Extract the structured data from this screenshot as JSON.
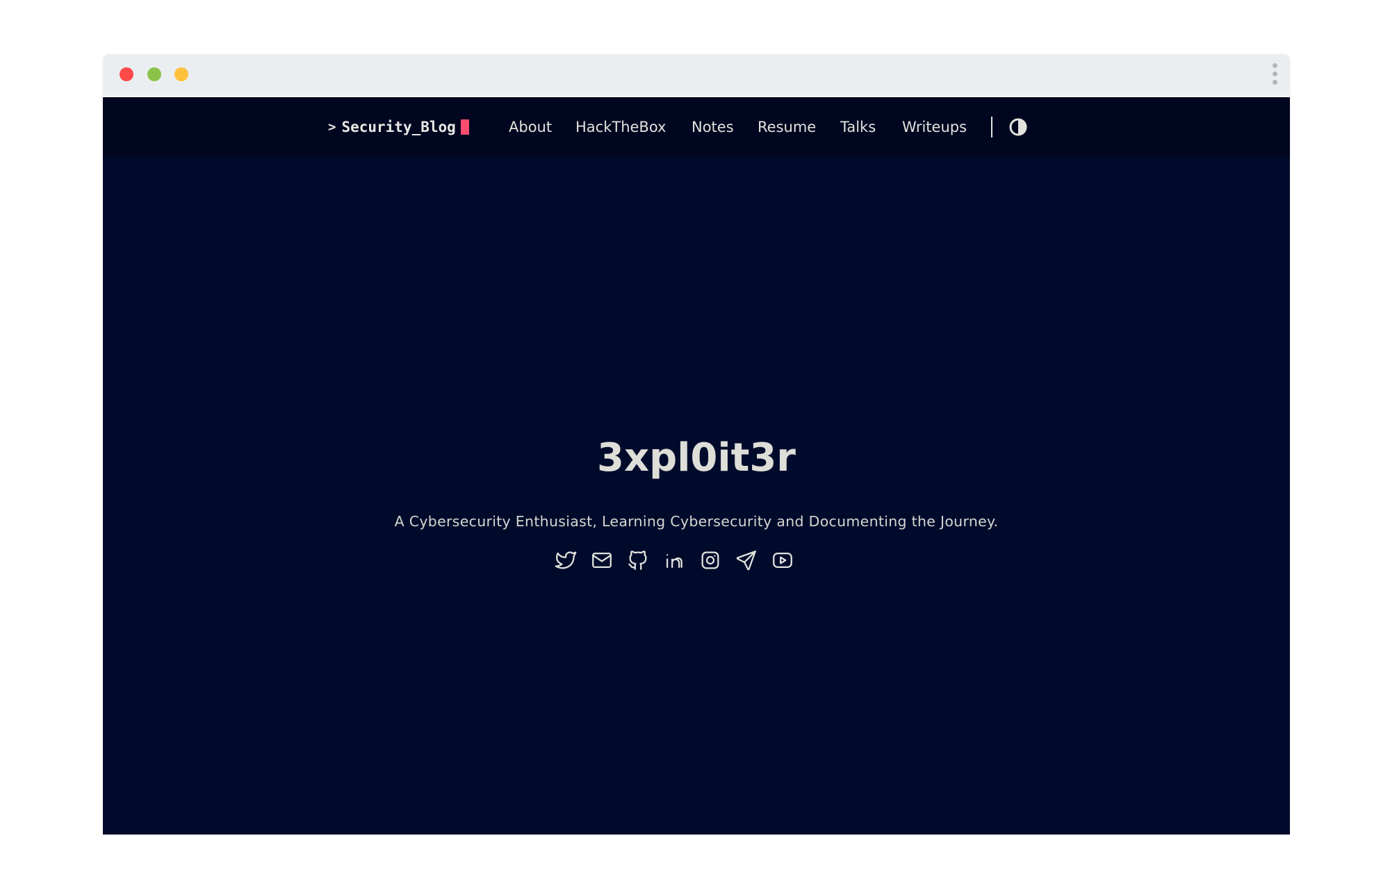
{
  "colors": {
    "page_background": "#000b2c",
    "nav_background": "#00061f",
    "text": "#e3e3dd",
    "cursor_accent": "#ff4d70",
    "window_red": "#ff4a4a",
    "window_green": "#8bc34a",
    "window_yellow": "#ffc13b",
    "chrome_gray": "#ebeef0",
    "menu_dots": "#b3b6b9"
  },
  "nav": {
    "logo_prompt": ">",
    "logo_text": "Security_Blog",
    "links": [
      "About",
      "HackTheBox",
      "Notes",
      "Resume",
      "Talks",
      "Writeups"
    ],
    "theme_toggle_icon": "contrast-icon"
  },
  "hero": {
    "title": "3xpl0it3r",
    "subtitle": "A Cybersecurity Enthusiast, Learning Cybersecurity and Documenting the Journey."
  },
  "social": [
    "twitter-icon",
    "mail-icon",
    "github-icon",
    "linkedin-icon",
    "instagram-icon",
    "telegram-icon",
    "youtube-icon"
  ]
}
